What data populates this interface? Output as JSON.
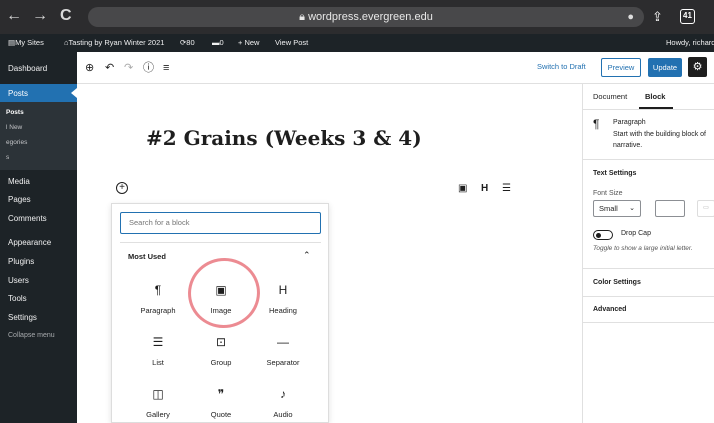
{
  "browser": {
    "url": "wordpress.evergreen.edu",
    "tab_count": "41"
  },
  "admin_bar": {
    "my_sites": "My Sites",
    "site_name": "Tasting by Ryan Winter 2021",
    "updates_count": "80",
    "comments_count": "0",
    "new_label": "+ New",
    "view_post": "View Post",
    "howdy": "Howdy, richard"
  },
  "sidebar": {
    "dashboard": "Dashboard",
    "posts": "Posts",
    "sub_posts": "Posts",
    "sub_add_new": "l New",
    "sub_categories": "egories",
    "sub_tags": "s",
    "media": "Media",
    "pages": "Pages",
    "comments": "Comments",
    "appearance": "Appearance",
    "plugins": "Plugins",
    "users": "Users",
    "tools": "Tools",
    "settings": "Settings",
    "collapse": "Collapse menu"
  },
  "toolbar": {
    "switch_to_draft": "Switch to Draft",
    "preview": "Preview",
    "update": "Update"
  },
  "editor": {
    "post_title": "#2 Grains (Weeks 3 & 4)"
  },
  "inserter": {
    "search_placeholder": "Search for a block",
    "section_title": "Most Used",
    "blocks": [
      {
        "label": "Paragraph",
        "icon": "¶"
      },
      {
        "label": "Image",
        "icon": "▣"
      },
      {
        "label": "Heading",
        "icon": "H"
      },
      {
        "label": "List",
        "icon": "☰"
      },
      {
        "label": "Group",
        "icon": "⊡"
      },
      {
        "label": "Separator",
        "icon": "—"
      },
      {
        "label": "Gallery",
        "icon": "◫"
      },
      {
        "label": "Quote",
        "icon": "❞"
      },
      {
        "label": "Audio",
        "icon": "♪"
      }
    ]
  },
  "settings_panel": {
    "tab_document": "Document",
    "tab_block": "Block",
    "block_name": "Paragraph",
    "block_desc_1": "Start with the building block of",
    "block_desc_2": "narrative.",
    "text_settings": "Text Settings",
    "font_size_label": "Font Size",
    "font_size_value": "Small",
    "drop_cap": "Drop Cap",
    "drop_cap_help": "Toggle to show a large initial letter.",
    "color_settings": "Color Settings",
    "advanced": "Advanced"
  }
}
